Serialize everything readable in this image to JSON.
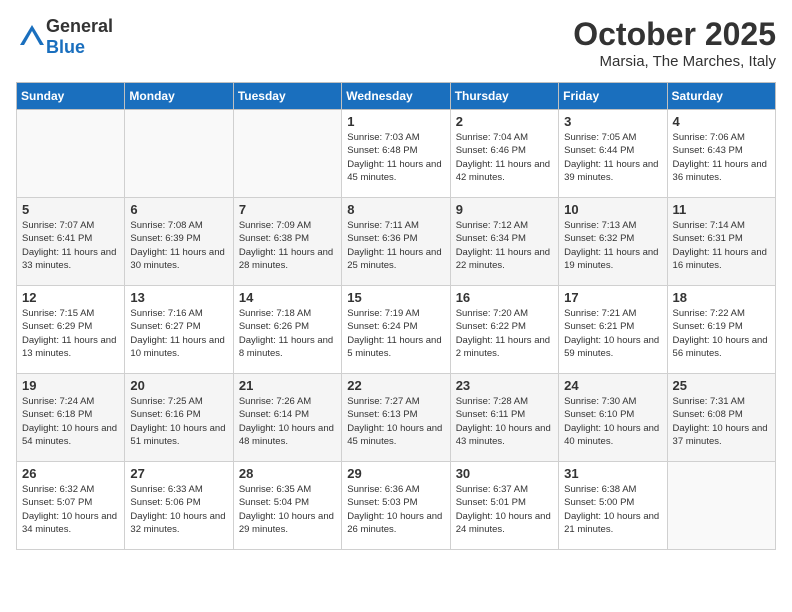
{
  "header": {
    "logo_general": "General",
    "logo_blue": "Blue",
    "month": "October 2025",
    "location": "Marsia, The Marches, Italy"
  },
  "days_of_week": [
    "Sunday",
    "Monday",
    "Tuesday",
    "Wednesday",
    "Thursday",
    "Friday",
    "Saturday"
  ],
  "weeks": [
    [
      {
        "day": "",
        "sunrise": "",
        "sunset": "",
        "daylight": ""
      },
      {
        "day": "",
        "sunrise": "",
        "sunset": "",
        "daylight": ""
      },
      {
        "day": "",
        "sunrise": "",
        "sunset": "",
        "daylight": ""
      },
      {
        "day": "1",
        "sunrise": "Sunrise: 7:03 AM",
        "sunset": "Sunset: 6:48 PM",
        "daylight": "Daylight: 11 hours and 45 minutes."
      },
      {
        "day": "2",
        "sunrise": "Sunrise: 7:04 AM",
        "sunset": "Sunset: 6:46 PM",
        "daylight": "Daylight: 11 hours and 42 minutes."
      },
      {
        "day": "3",
        "sunrise": "Sunrise: 7:05 AM",
        "sunset": "Sunset: 6:44 PM",
        "daylight": "Daylight: 11 hours and 39 minutes."
      },
      {
        "day": "4",
        "sunrise": "Sunrise: 7:06 AM",
        "sunset": "Sunset: 6:43 PM",
        "daylight": "Daylight: 11 hours and 36 minutes."
      }
    ],
    [
      {
        "day": "5",
        "sunrise": "Sunrise: 7:07 AM",
        "sunset": "Sunset: 6:41 PM",
        "daylight": "Daylight: 11 hours and 33 minutes."
      },
      {
        "day": "6",
        "sunrise": "Sunrise: 7:08 AM",
        "sunset": "Sunset: 6:39 PM",
        "daylight": "Daylight: 11 hours and 30 minutes."
      },
      {
        "day": "7",
        "sunrise": "Sunrise: 7:09 AM",
        "sunset": "Sunset: 6:38 PM",
        "daylight": "Daylight: 11 hours and 28 minutes."
      },
      {
        "day": "8",
        "sunrise": "Sunrise: 7:11 AM",
        "sunset": "Sunset: 6:36 PM",
        "daylight": "Daylight: 11 hours and 25 minutes."
      },
      {
        "day": "9",
        "sunrise": "Sunrise: 7:12 AM",
        "sunset": "Sunset: 6:34 PM",
        "daylight": "Daylight: 11 hours and 22 minutes."
      },
      {
        "day": "10",
        "sunrise": "Sunrise: 7:13 AM",
        "sunset": "Sunset: 6:32 PM",
        "daylight": "Daylight: 11 hours and 19 minutes."
      },
      {
        "day": "11",
        "sunrise": "Sunrise: 7:14 AM",
        "sunset": "Sunset: 6:31 PM",
        "daylight": "Daylight: 11 hours and 16 minutes."
      }
    ],
    [
      {
        "day": "12",
        "sunrise": "Sunrise: 7:15 AM",
        "sunset": "Sunset: 6:29 PM",
        "daylight": "Daylight: 11 hours and 13 minutes."
      },
      {
        "day": "13",
        "sunrise": "Sunrise: 7:16 AM",
        "sunset": "Sunset: 6:27 PM",
        "daylight": "Daylight: 11 hours and 10 minutes."
      },
      {
        "day": "14",
        "sunrise": "Sunrise: 7:18 AM",
        "sunset": "Sunset: 6:26 PM",
        "daylight": "Daylight: 11 hours and 8 minutes."
      },
      {
        "day": "15",
        "sunrise": "Sunrise: 7:19 AM",
        "sunset": "Sunset: 6:24 PM",
        "daylight": "Daylight: 11 hours and 5 minutes."
      },
      {
        "day": "16",
        "sunrise": "Sunrise: 7:20 AM",
        "sunset": "Sunset: 6:22 PM",
        "daylight": "Daylight: 11 hours and 2 minutes."
      },
      {
        "day": "17",
        "sunrise": "Sunrise: 7:21 AM",
        "sunset": "Sunset: 6:21 PM",
        "daylight": "Daylight: 10 hours and 59 minutes."
      },
      {
        "day": "18",
        "sunrise": "Sunrise: 7:22 AM",
        "sunset": "Sunset: 6:19 PM",
        "daylight": "Daylight: 10 hours and 56 minutes."
      }
    ],
    [
      {
        "day": "19",
        "sunrise": "Sunrise: 7:24 AM",
        "sunset": "Sunset: 6:18 PM",
        "daylight": "Daylight: 10 hours and 54 minutes."
      },
      {
        "day": "20",
        "sunrise": "Sunrise: 7:25 AM",
        "sunset": "Sunset: 6:16 PM",
        "daylight": "Daylight: 10 hours and 51 minutes."
      },
      {
        "day": "21",
        "sunrise": "Sunrise: 7:26 AM",
        "sunset": "Sunset: 6:14 PM",
        "daylight": "Daylight: 10 hours and 48 minutes."
      },
      {
        "day": "22",
        "sunrise": "Sunrise: 7:27 AM",
        "sunset": "Sunset: 6:13 PM",
        "daylight": "Daylight: 10 hours and 45 minutes."
      },
      {
        "day": "23",
        "sunrise": "Sunrise: 7:28 AM",
        "sunset": "Sunset: 6:11 PM",
        "daylight": "Daylight: 10 hours and 43 minutes."
      },
      {
        "day": "24",
        "sunrise": "Sunrise: 7:30 AM",
        "sunset": "Sunset: 6:10 PM",
        "daylight": "Daylight: 10 hours and 40 minutes."
      },
      {
        "day": "25",
        "sunrise": "Sunrise: 7:31 AM",
        "sunset": "Sunset: 6:08 PM",
        "daylight": "Daylight: 10 hours and 37 minutes."
      }
    ],
    [
      {
        "day": "26",
        "sunrise": "Sunrise: 6:32 AM",
        "sunset": "Sunset: 5:07 PM",
        "daylight": "Daylight: 10 hours and 34 minutes."
      },
      {
        "day": "27",
        "sunrise": "Sunrise: 6:33 AM",
        "sunset": "Sunset: 5:06 PM",
        "daylight": "Daylight: 10 hours and 32 minutes."
      },
      {
        "day": "28",
        "sunrise": "Sunrise: 6:35 AM",
        "sunset": "Sunset: 5:04 PM",
        "daylight": "Daylight: 10 hours and 29 minutes."
      },
      {
        "day": "29",
        "sunrise": "Sunrise: 6:36 AM",
        "sunset": "Sunset: 5:03 PM",
        "daylight": "Daylight: 10 hours and 26 minutes."
      },
      {
        "day": "30",
        "sunrise": "Sunrise: 6:37 AM",
        "sunset": "Sunset: 5:01 PM",
        "daylight": "Daylight: 10 hours and 24 minutes."
      },
      {
        "day": "31",
        "sunrise": "Sunrise: 6:38 AM",
        "sunset": "Sunset: 5:00 PM",
        "daylight": "Daylight: 10 hours and 21 minutes."
      },
      {
        "day": "",
        "sunrise": "",
        "sunset": "",
        "daylight": ""
      }
    ]
  ]
}
